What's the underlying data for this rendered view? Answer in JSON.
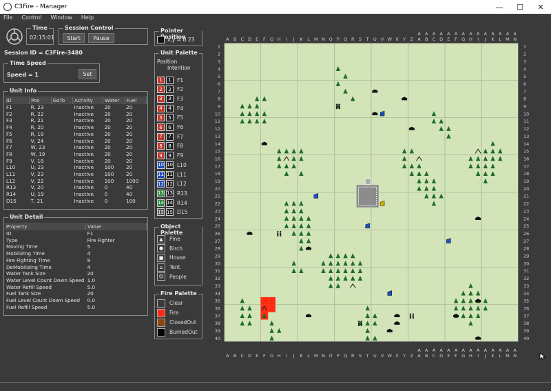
{
  "window": {
    "title": "C3Fire - Manager"
  },
  "menu": [
    "File",
    "Control",
    "Window",
    "Help"
  ],
  "time": {
    "label": "Time",
    "value": "02:15:01"
  },
  "session_control": {
    "label": "Session Control",
    "start": "Start",
    "pause": "Pause"
  },
  "session_id": "Session ID = C3Fire-3480",
  "time_speed": {
    "label": "Time Speed",
    "speed": "Speed = 1",
    "set": "Set"
  },
  "unit_info": {
    "label": "Unit Info",
    "columns": [
      "ID",
      "Pos",
      "GoTo",
      "Activity",
      "Water",
      "Fuel"
    ],
    "rows": [
      [
        "F1",
        "R, 23",
        "",
        "Inactive",
        "20",
        "20"
      ],
      [
        "F2",
        "R, 22",
        "",
        "Inactive",
        "20",
        "20"
      ],
      [
        "F3",
        "R, 21",
        "",
        "Inactive",
        "20",
        "20"
      ],
      [
        "F4",
        "R, 20",
        "",
        "Inactive",
        "20",
        "20"
      ],
      [
        "F5",
        "R, 19",
        "",
        "Inactive",
        "20",
        "20"
      ],
      [
        "F6",
        "V, 24",
        "",
        "Inactive",
        "20",
        "20"
      ],
      [
        "F7",
        "W, 23",
        "",
        "Inactive",
        "20",
        "20"
      ],
      [
        "F8",
        "W, 19",
        "",
        "Inactive",
        "20",
        "20"
      ],
      [
        "F9",
        "V, 18",
        "",
        "Inactive",
        "20",
        "20"
      ],
      [
        "L10",
        "U, 23",
        "",
        "Inactive",
        "100",
        "20"
      ],
      [
        "L11",
        "V, 23",
        "",
        "Inactive",
        "100",
        "20"
      ],
      [
        "L12",
        "V, 22",
        "",
        "Inactive",
        "100",
        "1000"
      ],
      [
        "R13",
        "V, 20",
        "",
        "Inactive",
        "0",
        "40"
      ],
      [
        "R14",
        "U, 19",
        "",
        "Inactive",
        "0",
        "40"
      ],
      [
        "D15",
        "T, 21",
        "",
        "Inactive",
        "0",
        "100"
      ]
    ]
  },
  "unit_detail": {
    "label": "Unit Detail",
    "columns": [
      "Property",
      "Value"
    ],
    "rows": [
      [
        "ID",
        "F1"
      ],
      [
        "Type",
        "Fire Fighter"
      ],
      [
        "Moving Time",
        "5"
      ],
      [
        "Mobilizing Time",
        "4"
      ],
      [
        "Fire Fighting Time",
        "8"
      ],
      [
        "DeMobilizing Time",
        "4"
      ],
      [
        "Water Tank Size",
        "20"
      ],
      [
        "Water Level Count Down Speed",
        "1.0"
      ],
      [
        "Water Refill Speed",
        "5.0"
      ],
      [
        "Fuel Tank Size",
        "20"
      ],
      [
        "Fuel Level Count Down Speed",
        "0.0"
      ],
      [
        "Fuel Refill Speed",
        "5.0"
      ]
    ]
  },
  "pointer_position": {
    "label": "Pointer Position",
    "text": "x,y =   B 23"
  },
  "unit_palette": {
    "label": "Unit Palette",
    "header1": "Position",
    "header2": "Intention",
    "items": [
      {
        "n": "1",
        "name": "F1",
        "color": "#c0392b"
      },
      {
        "n": "2",
        "name": "F2",
        "color": "#c0392b"
      },
      {
        "n": "3",
        "name": "F3",
        "color": "#c0392b"
      },
      {
        "n": "4",
        "name": "F4",
        "color": "#c0392b"
      },
      {
        "n": "5",
        "name": "F5",
        "color": "#c0392b"
      },
      {
        "n": "6",
        "name": "F6",
        "color": "#c0392b"
      },
      {
        "n": "7",
        "name": "F7",
        "color": "#c0392b"
      },
      {
        "n": "8",
        "name": "F8",
        "color": "#c0392b"
      },
      {
        "n": "9",
        "name": "F9",
        "color": "#c0392b"
      },
      {
        "n": "10",
        "name": "L10",
        "color": "#1f4fbf"
      },
      {
        "n": "11",
        "name": "L11",
        "color": "#1f4fbf"
      },
      {
        "n": "12",
        "name": "L12",
        "color": "#1f4fbf"
      },
      {
        "n": "13",
        "name": "R13",
        "color": "#2e8b3e"
      },
      {
        "n": "14",
        "name": "R14",
        "color": "#2e8b3e"
      },
      {
        "n": "15",
        "name": "D15",
        "color": "#555555"
      }
    ]
  },
  "object_palette": {
    "label": "Object Palette",
    "items": [
      {
        "name": "Pine",
        "icon": "pine-icon",
        "glyph": "▲"
      },
      {
        "name": "Birch",
        "icon": "birch-icon",
        "glyph": "●"
      },
      {
        "name": "House",
        "icon": "house-icon",
        "glyph": "■"
      },
      {
        "name": "Tent",
        "icon": "tent-icon",
        "glyph": "⌂"
      },
      {
        "name": "People",
        "icon": "people-icon",
        "glyph": "☺"
      }
    ]
  },
  "fire_palette": {
    "label": "Fire Palette",
    "items": [
      {
        "name": "Clear",
        "color": "#3c3c3c"
      },
      {
        "name": "Fire",
        "color": "#ff2a10"
      },
      {
        "name": "ClosedOut",
        "color": "#8b4513"
      },
      {
        "name": "BurnedOut",
        "color": "#000000"
      }
    ]
  },
  "map": {
    "columns": [
      "A",
      "B",
      "C",
      "D",
      "E",
      "F",
      "G",
      "H",
      "I",
      "J",
      "K",
      "L",
      "M",
      "N",
      "O",
      "P",
      "Q",
      "R",
      "S",
      "T",
      "U",
      "V",
      "W",
      "X",
      "Y",
      "Z",
      "AA",
      "AB",
      "AC",
      "AD",
      "AE",
      "AF",
      "AG",
      "AH",
      "AI",
      "AJ",
      "AK",
      "AL",
      "AM",
      "AN"
    ],
    "rows": 40,
    "colors": {
      "ground": "#d2e4b8",
      "tree": "#1e6b2a",
      "house": "#111111",
      "fire": "#ff2a10"
    },
    "fire_cells": [
      [
        5,
        34
      ],
      [
        6,
        34
      ],
      [
        5,
        35
      ],
      [
        6,
        35
      ],
      [
        5,
        36
      ]
    ],
    "houses": [
      [
        20,
        6
      ],
      [
        24,
        7
      ],
      [
        20,
        9
      ],
      [
        25,
        11
      ],
      [
        5,
        13
      ],
      [
        3,
        25
      ],
      [
        11,
        27
      ],
      [
        34,
        23
      ],
      [
        34,
        34
      ],
      [
        23,
        36
      ],
      [
        11,
        36
      ],
      [
        31,
        36
      ],
      [
        22,
        38
      ],
      [
        23,
        37
      ],
      [
        34,
        39
      ]
    ],
    "tents": [
      [
        8,
        15
      ],
      [
        26,
        15
      ],
      [
        34,
        14
      ],
      [
        17,
        32
      ],
      [
        5,
        35
      ]
    ],
    "people": [
      [
        15,
        8
      ],
      [
        7,
        25
      ],
      [
        18,
        37
      ],
      [
        25,
        36
      ]
    ],
    "units": [
      [
        12,
        20,
        "#1f4fbf"
      ],
      [
        21,
        9,
        "#1f4fbf"
      ],
      [
        19,
        24,
        "#1f4fbf"
      ],
      [
        30,
        26,
        "#1f4fbf"
      ],
      [
        22,
        33,
        "#1f4fbf"
      ],
      [
        21,
        21,
        "#d4b000"
      ]
    ],
    "forests": [
      [
        [
          15,
          3
        ],
        [
          16,
          4
        ],
        [
          15,
          5
        ],
        [
          16,
          6
        ],
        [
          17,
          7
        ],
        [
          15,
          8
        ]
      ],
      [
        [
          2,
          8
        ],
        [
          3,
          8
        ],
        [
          4,
          8
        ],
        [
          5,
          7
        ],
        [
          2,
          9
        ],
        [
          3,
          9
        ],
        [
          4,
          9
        ],
        [
          5,
          9
        ],
        [
          2,
          10
        ],
        [
          3,
          10
        ],
        [
          4,
          10
        ],
        [
          5,
          10
        ],
        [
          4,
          7
        ]
      ],
      [
        [
          28,
          9
        ],
        [
          29,
          10
        ],
        [
          28,
          10
        ],
        [
          29,
          11
        ],
        [
          30,
          11
        ],
        [
          30,
          12
        ]
      ],
      [
        [
          7,
          14
        ],
        [
          8,
          14
        ],
        [
          9,
          14
        ],
        [
          10,
          14
        ],
        [
          7,
          15
        ],
        [
          9,
          15
        ],
        [
          10,
          15
        ],
        [
          7,
          16
        ],
        [
          8,
          16
        ],
        [
          9,
          16
        ],
        [
          8,
          17
        ],
        [
          10,
          17
        ]
      ],
      [
        [
          24,
          14
        ],
        [
          25,
          14
        ],
        [
          24,
          15
        ],
        [
          26,
          16
        ],
        [
          25,
          17
        ],
        [
          26,
          17
        ],
        [
          27,
          17
        ],
        [
          26,
          18
        ],
        [
          27,
          18
        ],
        [
          28,
          18
        ],
        [
          26,
          19
        ],
        [
          27,
          19
        ],
        [
          28,
          19
        ],
        [
          27,
          20
        ],
        [
          28,
          20
        ],
        [
          29,
          20
        ],
        [
          28,
          21
        ],
        [
          24,
          16
        ],
        [
          25,
          16
        ]
      ],
      [
        [
          36,
          13
        ],
        [
          35,
          14
        ],
        [
          36,
          14
        ],
        [
          37,
          14
        ],
        [
          33,
          15
        ],
        [
          34,
          15
        ],
        [
          35,
          15
        ],
        [
          36,
          15
        ],
        [
          37,
          15
        ],
        [
          33,
          16
        ],
        [
          34,
          16
        ],
        [
          35,
          16
        ],
        [
          36,
          16
        ],
        [
          34,
          17
        ],
        [
          35,
          17
        ],
        [
          36,
          17
        ],
        [
          35,
          18
        ]
      ],
      [
        [
          8,
          21
        ],
        [
          9,
          21
        ],
        [
          10,
          21
        ],
        [
          8,
          22
        ],
        [
          9,
          22
        ],
        [
          10,
          22
        ],
        [
          8,
          23
        ],
        [
          9,
          23
        ],
        [
          10,
          23
        ],
        [
          11,
          23
        ],
        [
          8,
          24
        ],
        [
          9,
          24
        ],
        [
          10,
          24
        ],
        [
          11,
          24
        ],
        [
          9,
          25
        ],
        [
          10,
          25
        ],
        [
          11,
          25
        ],
        [
          10,
          26
        ],
        [
          11,
          26
        ],
        [
          10,
          27
        ]
      ],
      [
        [
          9,
          29
        ],
        [
          9,
          30
        ],
        [
          10,
          30
        ]
      ],
      [
        [
          14,
          28
        ],
        [
          15,
          28
        ],
        [
          16,
          28
        ],
        [
          17,
          28
        ],
        [
          13,
          29
        ],
        [
          14,
          29
        ],
        [
          15,
          29
        ],
        [
          16,
          29
        ],
        [
          17,
          29
        ],
        [
          18,
          29
        ],
        [
          13,
          30
        ],
        [
          14,
          30
        ],
        [
          15,
          30
        ],
        [
          16,
          30
        ],
        [
          17,
          30
        ],
        [
          18,
          30
        ],
        [
          14,
          31
        ],
        [
          15,
          31
        ],
        [
          16,
          31
        ],
        [
          17,
          31
        ],
        [
          18,
          31
        ],
        [
          14,
          32
        ],
        [
          15,
          32
        ]
      ],
      [
        [
          33,
          32
        ],
        [
          32,
          33
        ],
        [
          33,
          33
        ],
        [
          34,
          33
        ],
        [
          31,
          34
        ],
        [
          32,
          34
        ],
        [
          33,
          34
        ],
        [
          34,
          34
        ],
        [
          35,
          34
        ],
        [
          31,
          35
        ],
        [
          32,
          35
        ],
        [
          33,
          35
        ],
        [
          34,
          35
        ],
        [
          35,
          35
        ],
        [
          31,
          36
        ],
        [
          32,
          36
        ],
        [
          33,
          36
        ],
        [
          34,
          36
        ],
        [
          33,
          37
        ]
      ],
      [
        [
          2,
          34
        ],
        [
          2,
          35
        ],
        [
          3,
          35
        ],
        [
          2,
          36
        ],
        [
          3,
          36
        ],
        [
          2,
          37
        ],
        [
          3,
          37
        ],
        [
          5,
          36
        ],
        [
          6,
          37
        ],
        [
          6,
          38
        ],
        [
          7,
          38
        ],
        [
          6,
          39
        ]
      ],
      [
        [
          19,
          35
        ],
        [
          19,
          36
        ],
        [
          20,
          36
        ],
        [
          18,
          37
        ],
        [
          19,
          37
        ],
        [
          20,
          37
        ],
        [
          19,
          38
        ],
        [
          19,
          39
        ],
        [
          20,
          39
        ]
      ]
    ]
  }
}
